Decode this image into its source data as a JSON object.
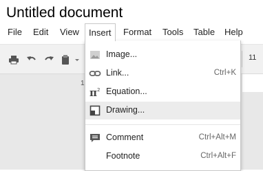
{
  "document": {
    "title": "Untitled document"
  },
  "menubar": {
    "items": [
      {
        "label": "File"
      },
      {
        "label": "Edit"
      },
      {
        "label": "View"
      },
      {
        "label": "Insert"
      },
      {
        "label": "Format"
      },
      {
        "label": "Tools"
      },
      {
        "label": "Table"
      },
      {
        "label": "Help"
      }
    ],
    "open_menu": "Insert"
  },
  "toolbar": {
    "icons": [
      "print-icon",
      "undo-icon",
      "redo-icon",
      "paint-format-icon"
    ],
    "zoom_fragment": "11"
  },
  "ruler": {
    "marker": "1"
  },
  "insert_menu": {
    "items": [
      {
        "label": "Image...",
        "shortcut": "",
        "icon": "image-icon"
      },
      {
        "label": "Link...",
        "shortcut": "Ctrl+K",
        "icon": "link-icon"
      },
      {
        "label": "Equation...",
        "shortcut": "",
        "icon": "equation-icon"
      },
      {
        "label": "Drawing...",
        "shortcut": "",
        "icon": "drawing-icon",
        "highlighted": true
      },
      {
        "label": "Comment",
        "shortcut": "Ctrl+Alt+M",
        "icon": "comment-icon"
      },
      {
        "label": "Footnote",
        "shortcut": "Ctrl+Alt+F",
        "icon": ""
      }
    ]
  },
  "colors": {
    "highlight": "#ececec",
    "toolbar_bg": "#f1f1f1",
    "doc_bg": "#e8e8e8"
  }
}
